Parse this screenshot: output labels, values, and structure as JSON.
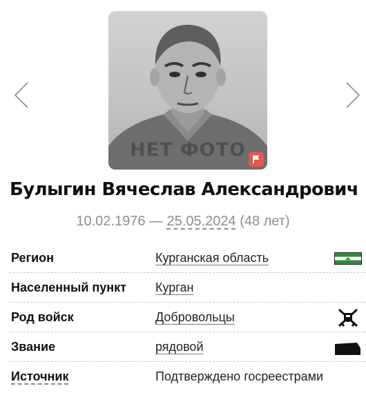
{
  "person": {
    "photo_placeholder": "НЕТ ФОТО",
    "name": "Булыгин Вячеслав Александрович",
    "birth_date": "10.02.1976",
    "dash": " — ",
    "death_date": "25.05.2024",
    "age": " (48 лет)"
  },
  "details": [
    {
      "label": "Регион",
      "value": "Курганская область",
      "icon": "region-flag-icon"
    },
    {
      "label": "Населенный пункт",
      "value": "Курган",
      "icon": ""
    },
    {
      "label": "Род войск",
      "value": "Добровольцы",
      "icon": "volunteers-emblem-icon"
    },
    {
      "label": "Звание",
      "value": "рядовой",
      "icon": "rank-insignia-icon"
    },
    {
      "label": "Источник",
      "value": "Подтверждено госреестрами",
      "icon": ""
    }
  ],
  "colors": {
    "flag_green": "#2e8b3a",
    "report_button": "#e2574c",
    "muted_text": "#8d8d8d"
  }
}
